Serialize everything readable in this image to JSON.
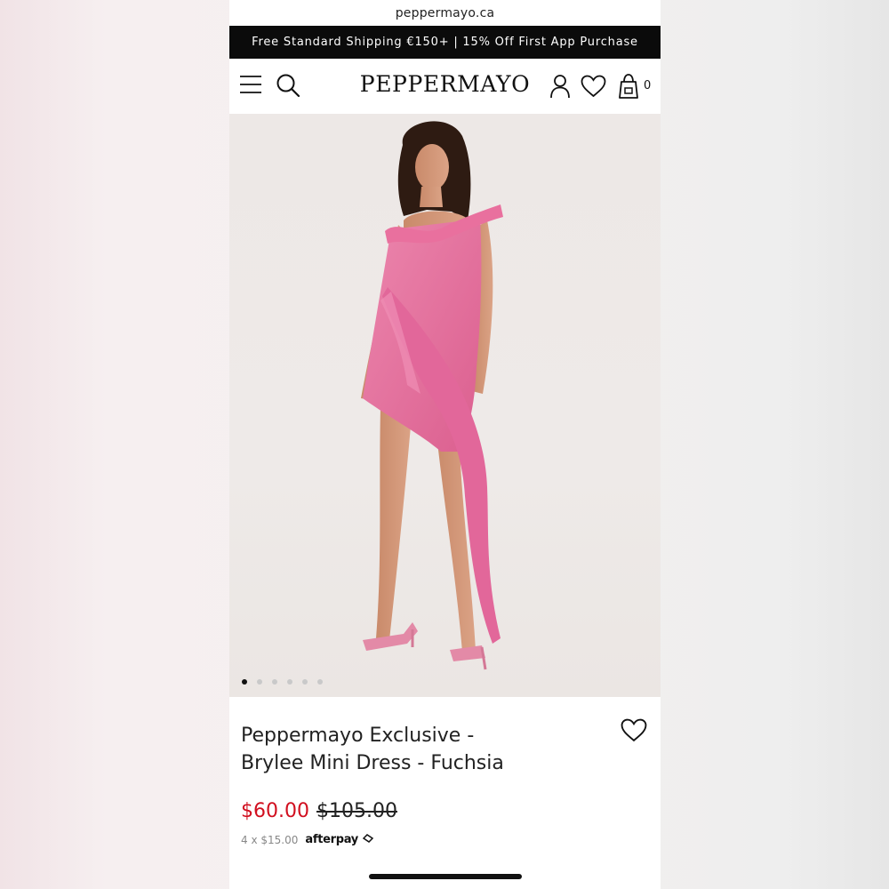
{
  "browser": {
    "url": "peppermayo.ca"
  },
  "promo": {
    "text": "Free Standard Shipping €150+ | 15% Off First App Purchase"
  },
  "header": {
    "logo": "PEPPERMAYO",
    "cart_count": "0",
    "icons": [
      "menu-icon",
      "search-icon",
      "account-icon",
      "heart-icon",
      "bag-icon"
    ]
  },
  "gallery": {
    "image_count": 6,
    "active_index": 0
  },
  "product": {
    "title_line1": "Peppermayo Exclusive -",
    "title_line2": "Brylee Mini Dress - Fuchsia",
    "sale_price": "$60.00",
    "original_price": "$105.00",
    "installments": "4 x $15.00",
    "afterpay_label": "afterpay"
  },
  "colors": {
    "accent_sale": "#d10f1f",
    "promo_bg": "#0b0b0b",
    "dress": "#e77aa3"
  }
}
